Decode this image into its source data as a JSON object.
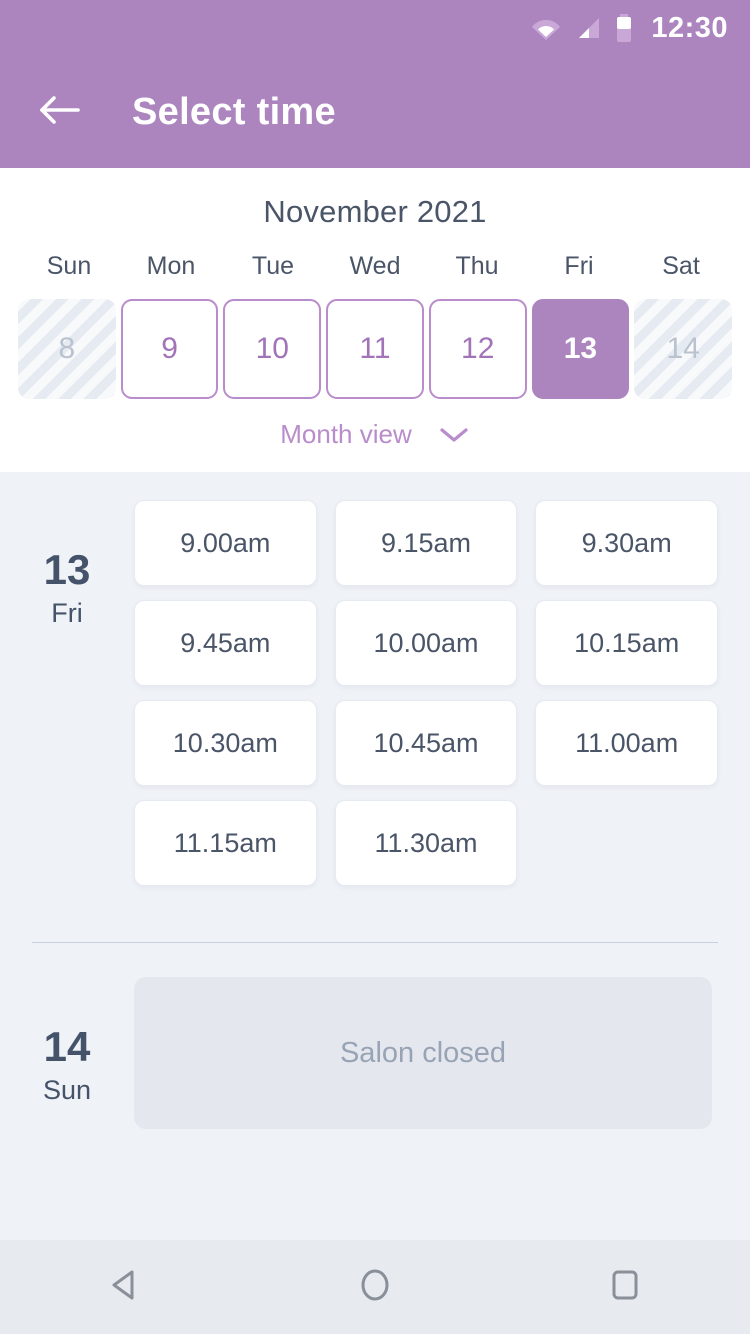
{
  "statusbar": {
    "time": "12:30",
    "icons": [
      "wifi-icon",
      "cellular-signal-icon",
      "battery-icon"
    ]
  },
  "appbar": {
    "back_icon": "arrow-left-icon",
    "title": "Select time"
  },
  "calendar": {
    "month_label": "November 2021",
    "weekdays": [
      "Sun",
      "Mon",
      "Tue",
      "Wed",
      "Thu",
      "Fri",
      "Sat"
    ],
    "days": [
      {
        "num": "8",
        "state": "disabled"
      },
      {
        "num": "9",
        "state": "available"
      },
      {
        "num": "10",
        "state": "available"
      },
      {
        "num": "11",
        "state": "available"
      },
      {
        "num": "12",
        "state": "available"
      },
      {
        "num": "13",
        "state": "selected"
      },
      {
        "num": "14",
        "state": "disabled"
      }
    ],
    "month_view_label": "Month view",
    "month_view_icon": "chevron-down-icon"
  },
  "schedule": [
    {
      "day_num": "13",
      "day_of_week": "Fri",
      "slots": [
        "9.00am",
        "9.15am",
        "9.30am",
        "9.45am",
        "10.00am",
        "10.15am",
        "10.30am",
        "10.45am",
        "11.00am",
        "11.15am",
        "11.30am"
      ]
    },
    {
      "day_num": "14",
      "day_of_week": "Sun",
      "closed_message": "Salon closed"
    }
  ],
  "navbar": {
    "back": "nav-back-icon",
    "home": "nav-home-icon",
    "recents": "nav-recents-icon"
  },
  "colors": {
    "accent_purple": "#AC85BF",
    "accent_purple_light": "#B98CCB",
    "text_slate": "#4A5568",
    "content_bg": "#EFF2F7",
    "closed_bg": "#E4E8EE"
  }
}
